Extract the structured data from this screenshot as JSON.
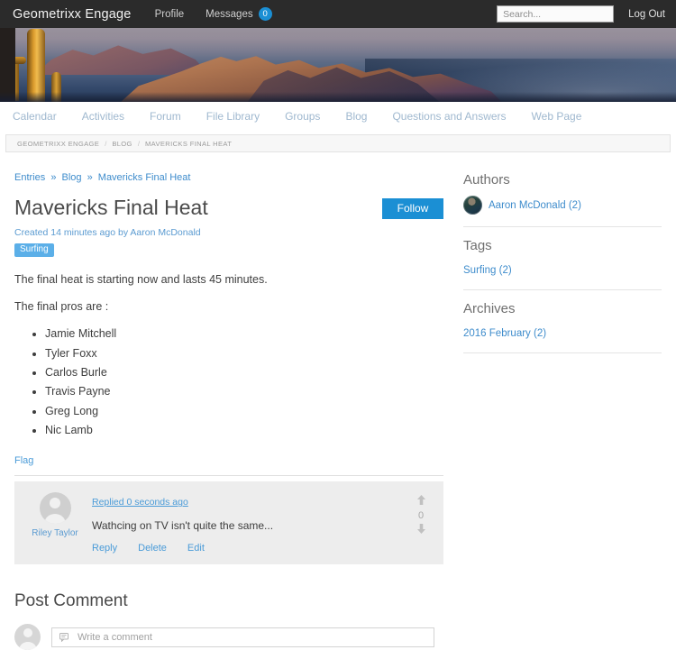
{
  "topbar": {
    "brand": "Geometrixx Engage",
    "nav": [
      {
        "label": "Profile",
        "name": "profile"
      },
      {
        "label": "Messages",
        "name": "messages",
        "badge": "0"
      }
    ],
    "search_placeholder": "Search...",
    "search_value": "",
    "logout_label": "Log Out"
  },
  "mainnav": [
    {
      "label": "Calendar"
    },
    {
      "label": "Activities"
    },
    {
      "label": "Forum"
    },
    {
      "label": "File Library"
    },
    {
      "label": "Groups"
    },
    {
      "label": "Blog"
    },
    {
      "label": "Questions and Answers"
    },
    {
      "label": "Web Page"
    }
  ],
  "breadcrumb": [
    "GEOMETRIXX ENGAGE",
    "BLOG",
    "MAVERICKS FINAL HEAT"
  ],
  "entry": {
    "crumbs": [
      {
        "label": "Entries"
      },
      {
        "label": "Blog"
      },
      {
        "label": "Mavericks Final Heat"
      }
    ],
    "crumb_sep": "»",
    "title": "Mavericks Final Heat",
    "follow_label": "Follow",
    "meta": "Created 14 minutes ago by Aaron McDonald",
    "tag": "Surfing",
    "paragraph_1": "The final heat is starting now and lasts 45 minutes.",
    "paragraph_2": "The final pros are :",
    "list": [
      "Jamie Mitchell",
      "Tyler Foxx",
      "Carlos Burle",
      "Travis Payne",
      "Greg Long",
      "Nic Lamb"
    ],
    "flag_label": "Flag"
  },
  "comment": {
    "author": "Riley Taylor",
    "time": "Replied 0 seconds ago",
    "text": "Wathcing on TV isn't quite the same...",
    "actions": [
      {
        "label": "Reply"
      },
      {
        "label": "Delete"
      },
      {
        "label": "Edit"
      }
    ],
    "vote_count": "0",
    "vote_up": "⬆",
    "vote_down": "⬇"
  },
  "post_comment": {
    "title": "Post Comment",
    "placeholder": "Write a comment",
    "value": ""
  },
  "sidebar": {
    "authors": {
      "title": "Authors",
      "items": [
        {
          "label": "Aaron McDonald (2)"
        }
      ]
    },
    "tags": {
      "title": "Tags",
      "items": [
        {
          "label": "Surfing (2)"
        }
      ]
    },
    "archives": {
      "title": "Archives",
      "items": [
        {
          "label": "2016 February (2)"
        }
      ]
    }
  },
  "colors": {
    "accent": "#1b8fd4",
    "link": "#3e8ccc",
    "tag_badge": "#5bafe8",
    "topbar_bg": "#2b2b2b"
  }
}
